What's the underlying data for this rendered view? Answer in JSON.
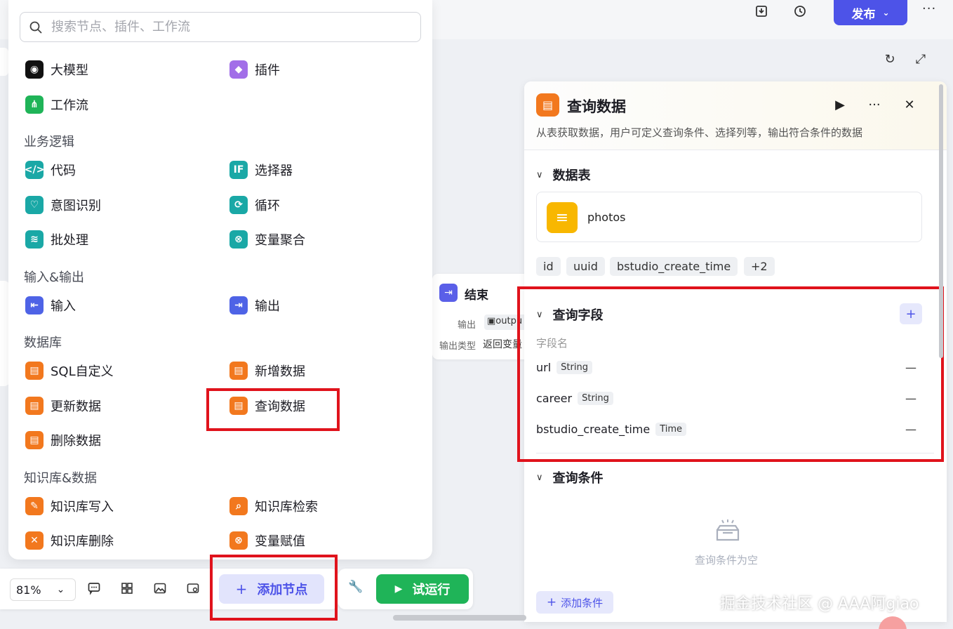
{
  "header": {
    "publish_label": "发布",
    "more_label": "···"
  },
  "picker": {
    "search_placeholder": "搜索节点、插件、工作流",
    "top_items": [
      {
        "label": "大模型",
        "icon": "llm-icon"
      },
      {
        "label": "插件",
        "icon": "plugin-icon"
      },
      {
        "label": "工作流",
        "icon": "workflow-icon"
      }
    ],
    "sections": [
      {
        "title": "业务逻辑",
        "items": [
          "代码",
          "选择器",
          "意图识别",
          "循环",
          "批处理",
          "变量聚合"
        ]
      },
      {
        "title": "输入&输出",
        "items": [
          "输入",
          "输出"
        ]
      },
      {
        "title": "数据库",
        "items": [
          "SQL自定义",
          "新增数据",
          "更新数据",
          "查询数据",
          "删除数据"
        ]
      },
      {
        "title": "知识库&数据",
        "items": [
          "知识库写入",
          "知识库检索",
          "知识库删除",
          "变量赋值"
        ]
      }
    ]
  },
  "end_node": {
    "title": "结束",
    "output_label": "输出",
    "output_value": "outpu",
    "output_type_label": "输出类型",
    "output_type_value": "返回变量"
  },
  "toolbar": {
    "zoom": "81%",
    "add_node_label": "添加节点",
    "run_label": "试运行"
  },
  "detail": {
    "title": "查询数据",
    "description": "从表获取数据，用户可定义查询条件、选择列等，输出符合条件的数据",
    "table_section": "数据表",
    "table_name": "photos",
    "columns": [
      "id",
      "uuid",
      "bstudio_create_time",
      "+2"
    ],
    "fields_section": "查询字段",
    "field_header": "字段名",
    "fields": [
      {
        "name": "url",
        "type": "String"
      },
      {
        "name": "career",
        "type": "String"
      },
      {
        "name": "bstudio_create_time",
        "type": "Time"
      }
    ],
    "conditions_section": "查询条件",
    "empty_text": "查询条件为空",
    "add_condition_label": "添加条件"
  },
  "watermark": "掘金技术社区 @ AAA阿giao",
  "colors": {
    "brand": "#4d53e8",
    "run_green": "#1fb458",
    "highlight_red": "#e0131c",
    "database_orange": "#f2781e"
  }
}
